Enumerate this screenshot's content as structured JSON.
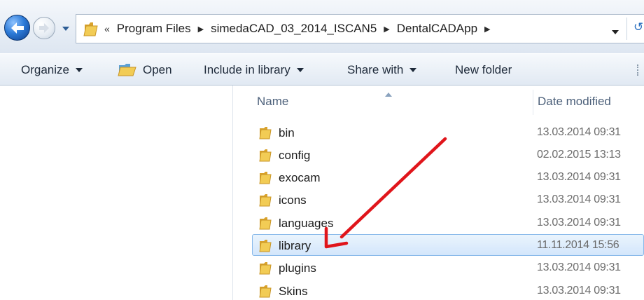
{
  "address_bar": {
    "overflow_chevron": "«",
    "path": [
      "Program Files",
      "simedaCAD_03_2014_ISCAN5",
      "DentalCADApp"
    ]
  },
  "toolbar": {
    "organize_label": "Organize",
    "open_label": "Open",
    "include_label": "Include in library",
    "share_label": "Share with",
    "new_folder_label": "New folder"
  },
  "columns": {
    "name": "Name",
    "date_modified": "Date modified"
  },
  "files": [
    {
      "name": "bin",
      "date": "13.03.2014 09:31",
      "selected": false
    },
    {
      "name": "config",
      "date": "02.02.2015 13:13",
      "selected": false
    },
    {
      "name": "exocam",
      "date": "13.03.2014 09:31",
      "selected": false
    },
    {
      "name": "icons",
      "date": "13.03.2014 09:31",
      "selected": false
    },
    {
      "name": "languages",
      "date": "13.03.2014 09:31",
      "selected": false
    },
    {
      "name": "library",
      "date": "11.11.2014 15:56",
      "selected": true
    },
    {
      "name": "plugins",
      "date": "13.03.2014 09:31",
      "selected": false
    },
    {
      "name": "Skins",
      "date": "13.03.2014 09:31",
      "selected": false
    }
  ],
  "colors": {
    "selection_bg": "#d3e6fb",
    "selection_border": "#88b9ea",
    "annotation_arrow": "#e0151b",
    "folder": "#e8b93c"
  }
}
